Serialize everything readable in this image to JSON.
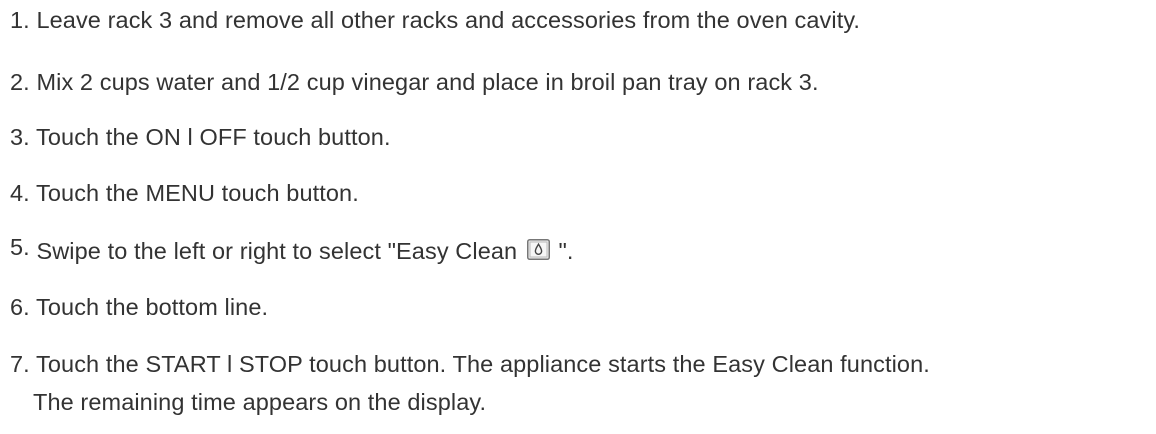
{
  "steps": [
    {
      "number": "1.",
      "text": " Leave rack 3 and remove all other racks and accessories from the oven cavity."
    },
    {
      "number": "2.",
      "text": " Mix 2 cups water and 1/2 cup vinegar and place in broil pan tray on rack 3."
    },
    {
      "number": "3.",
      "text": " Touch the ON l OFF touch button."
    },
    {
      "number": "4.",
      "text": " Touch the MENU touch button."
    },
    {
      "number": "5.",
      "text_before": " Swipe to the left or right to select \"Easy Clean ",
      "icon": "easy-clean-drop-icon",
      "text_after": " \"."
    },
    {
      "number": "6.",
      "text": " Touch the bottom line."
    },
    {
      "number": "7.",
      "text": " Touch the START l STOP touch button. The appliance starts the Easy Clean function.",
      "continuation": "The remaining time appears on the display."
    }
  ]
}
